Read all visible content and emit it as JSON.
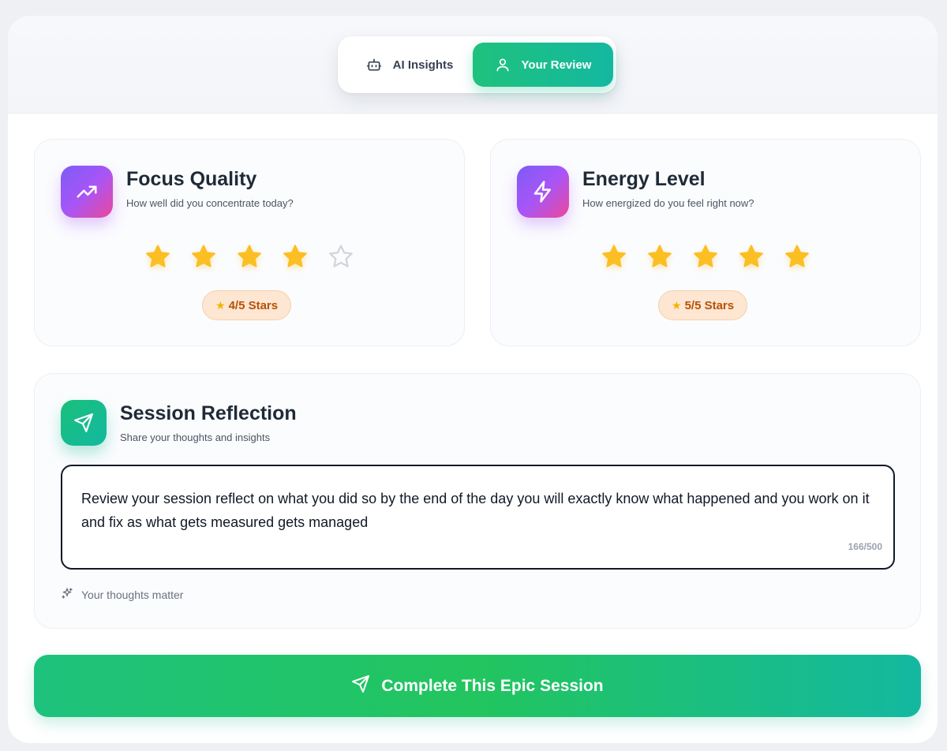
{
  "tabs": {
    "ai_insights_label": "AI Insights",
    "your_review_label": "Your Review",
    "active": "Your Review"
  },
  "focus": {
    "title": "Focus Quality",
    "subtitle": "How well did you concentrate today?",
    "rating": 4,
    "max": 5,
    "badge": "4/5 Stars",
    "icon": "trending-up-icon"
  },
  "energy": {
    "title": "Energy Level",
    "subtitle": "How energized do you feel right now?",
    "rating": 5,
    "max": 5,
    "badge": "5/5 Stars",
    "icon": "zap-icon"
  },
  "reflection": {
    "title": "Session Reflection",
    "subtitle": "Share your thoughts and insights",
    "value": "Review your session reflect on what you did so by the end of the day you will exactly know what happened and you work on it and fix as what gets measured gets managed",
    "counter": "166/500",
    "hint": "Your thoughts matter",
    "icon": "send-icon"
  },
  "cta": {
    "label": "Complete This Epic Session",
    "icon": "send-icon"
  },
  "colors": {
    "accent_green": "#1fc27c",
    "accent_teal": "#14b8a0",
    "star_filled": "#fbbf24",
    "star_empty": "#d1d5db",
    "badge_bg": "#fde6d2",
    "badge_text": "#b45309"
  }
}
